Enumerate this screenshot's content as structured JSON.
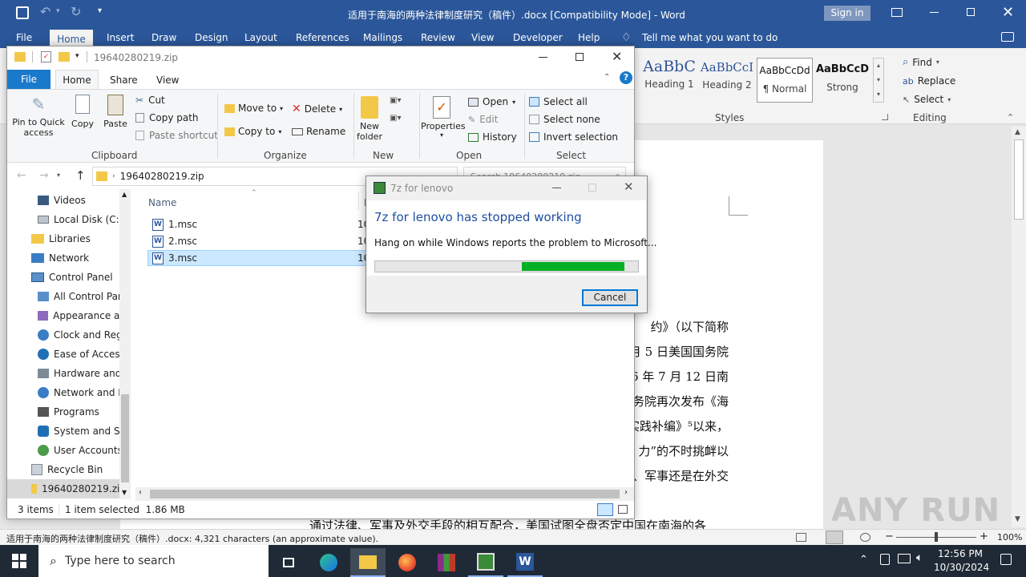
{
  "word": {
    "title": "适用于南海的两种法律制度研究（稿件）.docx [Compatibility Mode] - Word",
    "sign_in": "Sign in",
    "tabs": [
      "File",
      "Home",
      "Insert",
      "Draw",
      "Design",
      "Layout",
      "References",
      "Mailings",
      "Review",
      "View",
      "Developer",
      "Help"
    ],
    "tell_me": "Tell me what you want to do",
    "styles": [
      {
        "preview": "AaBbC",
        "name": "Heading 1"
      },
      {
        "preview": "AaBbCcI",
        "name": "Heading 2"
      },
      {
        "preview": "AaBbCcDd",
        "name": "¶ Normal"
      },
      {
        "preview": "AaBbCcD",
        "name": "Strong"
      }
    ],
    "styles_group": "Styles",
    "editing": {
      "find": "Find",
      "replace": "Replace",
      "select": "Select",
      "group": "Editing"
    },
    "doc_lines": [
      "约》（以下简称",
      "月 5 日美国国务院",
      "6 年 7 月 12 日南",
      "务院再次发布《海",
      "实践补编》⁵以来，",
      "力”的不时挑衅以",
      "、军事还是在外交",
      "通过法律、军事及外交手段的相互配合，美国试图全盘否定中国在南海的各"
    ],
    "status_text": "适用于南海的两种法律制度研究（稿件）.docx: 4,321 characters (an approximate value).",
    "zoom": "100%",
    "watermark": "ANY RUN"
  },
  "explorer": {
    "title": "19640280219.zip",
    "tabs": [
      "File",
      "Home",
      "Share",
      "View"
    ],
    "clipboard": {
      "pin": "Pin to Quick access",
      "copy": "Copy",
      "paste": "Paste",
      "cut": "Cut",
      "copy_path": "Copy path",
      "paste_shortcut": "Paste shortcut",
      "group": "Clipboard"
    },
    "organize": {
      "move_to": "Move to",
      "copy_to": "Copy to",
      "delete": "Delete",
      "rename": "Rename",
      "group": "Organize"
    },
    "new": {
      "new_folder": "New folder",
      "group": "New"
    },
    "open": {
      "properties": "Properties",
      "open": "Open",
      "edit": "Edit",
      "history": "History",
      "group": "Open"
    },
    "select": {
      "select_all": "Select all",
      "select_none": "Select none",
      "invert": "Invert selection",
      "group": "Select"
    },
    "address": "19640280219.zip",
    "search_placeholder": "Search 19640280219.zip",
    "nav_items": [
      "Videos",
      "Local Disk (C:)",
      "Libraries",
      "Network",
      "Control Panel",
      "All Control Par",
      "Appearance an",
      "Clock and Regi",
      "Ease of Access",
      "Hardware and",
      "Network and Ir",
      "Programs",
      "System and Se",
      "User Accounts",
      "Recycle Bin",
      "19640280219.zip"
    ],
    "column_name": "Name",
    "column_date": "Da",
    "files": [
      {
        "name": "1.msc",
        "date": "10"
      },
      {
        "name": "2.msc",
        "date": "10"
      },
      {
        "name": "3.msc",
        "date": "10"
      }
    ],
    "status_items": "3 items",
    "status_selected": "1 item selected  1.86 MB"
  },
  "dialog": {
    "title": "7z for lenovo",
    "heading": "7z for lenovo has stopped working",
    "message": "Hang on while Windows reports the problem to Microsoft...",
    "progress": 0.39,
    "cancel": "Cancel"
  },
  "taskbar": {
    "search_placeholder": "Type here to search",
    "time": "12:56 PM",
    "date": "10/30/2024"
  },
  "colors": {
    "word_blue": "#2b579a",
    "progress_green": "#06b025",
    "selection": "#cce8ff"
  }
}
